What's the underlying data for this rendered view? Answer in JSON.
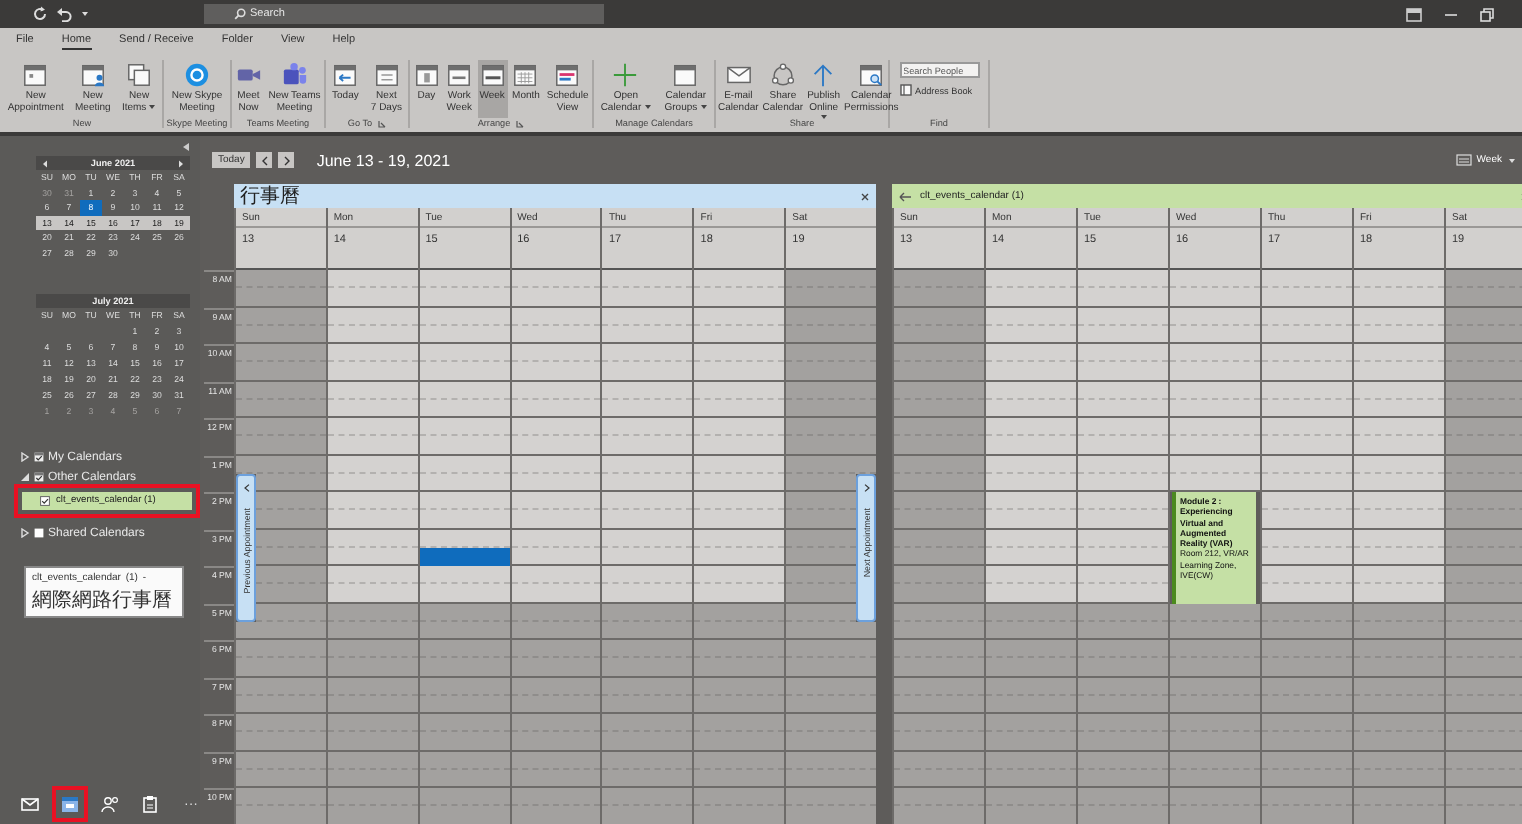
{
  "title_bar": {
    "search": {
      "placeholder": "Search"
    }
  },
  "ribbon_tabs": [
    {
      "label": "File",
      "selected": false
    },
    {
      "label": "Home",
      "selected": true
    },
    {
      "label": "Send / Receive",
      "selected": false
    },
    {
      "label": "Folder",
      "selected": false
    },
    {
      "label": "View",
      "selected": false
    },
    {
      "label": "Help",
      "selected": false
    }
  ],
  "ribbon_groups": [
    {
      "label": "New",
      "launcher": false,
      "items": [
        {
          "kind": "large",
          "label": "New\nAppointment",
          "dropdown": false,
          "selected": false
        },
        {
          "kind": "large",
          "label": "New\nMeeting",
          "dropdown": false,
          "selected": false
        },
        {
          "kind": "large",
          "label": "New\nItems",
          "dropdown": true,
          "selected": false
        }
      ]
    },
    {
      "label": "Skype Meeting",
      "launcher": false,
      "items": [
        {
          "kind": "large",
          "label": "New Skype\nMeeting",
          "dropdown": false,
          "selected": false
        }
      ]
    },
    {
      "label": "Teams Meeting",
      "launcher": false,
      "items": [
        {
          "kind": "large",
          "label": "Meet\nNow",
          "dropdown": false,
          "selected": false
        },
        {
          "kind": "large",
          "label": "New Teams\nMeeting",
          "dropdown": false,
          "selected": false
        }
      ]
    },
    {
      "label": "Go To",
      "launcher": true,
      "items": [
        {
          "kind": "large",
          "label": "Today",
          "dropdown": false,
          "selected": false
        },
        {
          "kind": "large",
          "label": "Next\n7 Days",
          "dropdown": false,
          "selected": false
        }
      ]
    },
    {
      "label": "Arrange",
      "launcher": true,
      "items": [
        {
          "kind": "large",
          "label": "Day",
          "dropdown": false,
          "selected": false
        },
        {
          "kind": "large",
          "label": "Work\nWeek",
          "dropdown": false,
          "selected": false
        },
        {
          "kind": "large",
          "label": "Week",
          "dropdown": false,
          "selected": true
        },
        {
          "kind": "large",
          "label": "Month",
          "dropdown": false,
          "selected": false
        },
        {
          "kind": "large",
          "label": "Schedule\nView",
          "dropdown": false,
          "selected": false
        }
      ]
    },
    {
      "label": "Manage Calendars",
      "launcher": false,
      "items": [
        {
          "kind": "large",
          "label": "Open\nCalendar",
          "dropdown": true,
          "selected": false
        },
        {
          "kind": "large",
          "label": "Calendar\nGroups",
          "dropdown": true,
          "selected": false
        }
      ]
    },
    {
      "label": "Share",
      "launcher": false,
      "items": [
        {
          "kind": "large",
          "label": "E-mail\nCalendar",
          "dropdown": false,
          "selected": false
        },
        {
          "kind": "large",
          "label": "Share\nCalendar",
          "dropdown": false,
          "selected": false
        },
        {
          "kind": "large",
          "label": "Publish\nOnline",
          "dropdown": true,
          "selected": false
        },
        {
          "kind": "large",
          "label": "Calendar\nPermissions",
          "dropdown": false,
          "selected": false
        }
      ]
    },
    {
      "label": "Find",
      "launcher": false,
      "items": [
        {
          "kind": "field",
          "placeholder": "Search People",
          "selected": false
        },
        {
          "kind": "small",
          "label": "Address Book",
          "dropdown": false,
          "selected": false
        }
      ]
    }
  ],
  "mini_months": [
    {
      "title": "June 2021",
      "arrows": true,
      "weekdays": [
        "SU",
        "MO",
        "TU",
        "WE",
        "TH",
        "FR",
        "SA"
      ],
      "weeks": [
        {
          "selected": false,
          "days": [
            {
              "day": "30",
              "other_month": true,
              "today": false
            },
            {
              "day": "31",
              "other_month": true,
              "today": false
            },
            {
              "day": "1",
              "other_month": false,
              "today": false
            },
            {
              "day": "2",
              "other_month": false,
              "today": false
            },
            {
              "day": "3",
              "other_month": false,
              "today": false
            },
            {
              "day": "4",
              "other_month": false,
              "today": false
            },
            {
              "day": "5",
              "other_month": false,
              "today": false
            }
          ]
        },
        {
          "selected": false,
          "days": [
            {
              "day": "6",
              "other_month": false,
              "today": false
            },
            {
              "day": "7",
              "other_month": false,
              "today": false
            },
            {
              "day": "8",
              "other_month": false,
              "today": true
            },
            {
              "day": "9",
              "other_month": false,
              "today": false
            },
            {
              "day": "10",
              "other_month": false,
              "today": false
            },
            {
              "day": "11",
              "other_month": false,
              "today": false
            },
            {
              "day": "12",
              "other_month": false,
              "today": false
            }
          ]
        },
        {
          "selected": true,
          "days": [
            {
              "day": "13",
              "other_month": false,
              "today": false
            },
            {
              "day": "14",
              "other_month": false,
              "today": false
            },
            {
              "day": "15",
              "other_month": false,
              "today": false
            },
            {
              "day": "16",
              "other_month": false,
              "today": false
            },
            {
              "day": "17",
              "other_month": false,
              "today": false
            },
            {
              "day": "18",
              "other_month": false,
              "today": false
            },
            {
              "day": "19",
              "other_month": false,
              "today": false
            }
          ]
        },
        {
          "selected": false,
          "days": [
            {
              "day": "20",
              "other_month": false,
              "today": false
            },
            {
              "day": "21",
              "other_month": false,
              "today": false
            },
            {
              "day": "22",
              "other_month": false,
              "today": false
            },
            {
              "day": "23",
              "other_month": false,
              "today": false
            },
            {
              "day": "24",
              "other_month": false,
              "today": false
            },
            {
              "day": "25",
              "other_month": false,
              "today": false
            },
            {
              "day": "26",
              "other_month": false,
              "today": false
            }
          ]
        },
        {
          "selected": false,
          "days": [
            {
              "day": "27",
              "other_month": false,
              "today": false
            },
            {
              "day": "28",
              "other_month": false,
              "today": false
            },
            {
              "day": "29",
              "other_month": false,
              "today": false
            },
            {
              "day": "30",
              "other_month": false,
              "today": false
            }
          ]
        }
      ]
    },
    {
      "title": "July 2021",
      "arrows": false,
      "weekdays": [
        "SU",
        "MO",
        "TU",
        "WE",
        "TH",
        "FR",
        "SA"
      ],
      "weeks": [
        {
          "selected": false,
          "days": [
            {
              "day": "1",
              "other_month": false,
              "today": false
            },
            {
              "day": "2",
              "other_month": false,
              "today": false
            },
            {
              "day": "3",
              "other_month": false,
              "today": false
            }
          ]
        },
        {
          "selected": false,
          "days": [
            {
              "day": "4",
              "other_month": false,
              "today": false
            },
            {
              "day": "5",
              "other_month": false,
              "today": false
            },
            {
              "day": "6",
              "other_month": false,
              "today": false
            },
            {
              "day": "7",
              "other_month": false,
              "today": false
            },
            {
              "day": "8",
              "other_month": false,
              "today": false
            },
            {
              "day": "9",
              "other_month": false,
              "today": false
            },
            {
              "day": "10",
              "other_month": false,
              "today": false
            }
          ]
        },
        {
          "selected": false,
          "days": [
            {
              "day": "11",
              "other_month": false,
              "today": false
            },
            {
              "day": "12",
              "other_month": false,
              "today": false
            },
            {
              "day": "13",
              "other_month": false,
              "today": false
            },
            {
              "day": "14",
              "other_month": false,
              "today": false
            },
            {
              "day": "15",
              "other_month": false,
              "today": false
            },
            {
              "day": "16",
              "other_month": false,
              "today": false
            },
            {
              "day": "17",
              "other_month": false,
              "today": false
            }
          ]
        },
        {
          "selected": false,
          "days": [
            {
              "day": "18",
              "other_month": false,
              "today": false
            },
            {
              "day": "19",
              "other_month": false,
              "today": false
            },
            {
              "day": "20",
              "other_month": false,
              "today": false
            },
            {
              "day": "21",
              "other_month": false,
              "today": false
            },
            {
              "day": "22",
              "other_month": false,
              "today": false
            },
            {
              "day": "23",
              "other_month": false,
              "today": false
            },
            {
              "day": "24",
              "other_month": false,
              "today": false
            }
          ]
        },
        {
          "selected": false,
          "days": [
            {
              "day": "25",
              "other_month": false,
              "today": false
            },
            {
              "day": "26",
              "other_month": false,
              "today": false
            },
            {
              "day": "27",
              "other_month": false,
              "today": false
            },
            {
              "day": "28",
              "other_month": false,
              "today": false
            },
            {
              "day": "29",
              "other_month": false,
              "today": false
            },
            {
              "day": "30",
              "other_month": false,
              "today": false
            },
            {
              "day": "31",
              "other_month": false,
              "today": false
            }
          ]
        },
        {
          "selected": false,
          "days": [
            {
              "day": "1",
              "other_month": true,
              "today": false
            },
            {
              "day": "2",
              "other_month": true,
              "today": false
            },
            {
              "day": "3",
              "other_month": true,
              "today": false
            },
            {
              "day": "4",
              "other_month": true,
              "today": false
            },
            {
              "day": "5",
              "other_month": true,
              "today": false
            },
            {
              "day": "6",
              "other_month": true,
              "today": false
            },
            {
              "day": "7",
              "other_month": true,
              "today": false
            }
          ]
        }
      ]
    }
  ],
  "calendar_groups": [
    {
      "label": "My Calendars",
      "expanded": false,
      "checked": true
    },
    {
      "label": "Other Calendars",
      "expanded": true,
      "checked": true,
      "items": [
        {
          "label": "clt_events_calendar (1)",
          "checked": true,
          "highlighted": true,
          "color": "#c5e0a5"
        }
      ]
    },
    {
      "label": "Shared Calendars",
      "expanded": false,
      "checked": false
    }
  ],
  "tooltip": {
    "text": "clt_events_calendar (1) - 網際網路行事曆"
  },
  "nav": {
    "items": [
      {
        "selected": false,
        "highlighted": false
      },
      {
        "selected": true,
        "highlighted": true
      },
      {
        "selected": false,
        "highlighted": false
      },
      {
        "selected": false,
        "highlighted": false
      }
    ],
    "more": "···"
  },
  "calendar_toolbar": {
    "today": "Today",
    "range": "June 13 - 19, 2021",
    "view": "Week"
  },
  "time_labels": [
    {
      "label": "8 AM",
      "work": true
    },
    {
      "label": "9 AM",
      "work": true
    },
    {
      "label": "10 AM",
      "work": true
    },
    {
      "label": "11 AM",
      "work": true
    },
    {
      "label": "12 PM",
      "work": true
    },
    {
      "label": "1 PM",
      "work": true
    },
    {
      "label": "2 PM",
      "work": true
    },
    {
      "label": "3 PM",
      "work": true
    },
    {
      "label": "4 PM",
      "work": true
    },
    {
      "label": "5 PM",
      "work": false
    },
    {
      "label": "6 PM",
      "work": false
    },
    {
      "label": "7 PM",
      "work": false
    },
    {
      "label": "8 PM",
      "work": false
    },
    {
      "label": "9 PM",
      "work": false
    },
    {
      "label": "10 PM",
      "work": false
    }
  ],
  "panels": [
    {
      "title": "行事曆",
      "color": "#c7e0f4",
      "back_arrow": false,
      "appointment_tabs": [
        {
          "kind": "previous",
          "label": "Previous Appointment"
        },
        {
          "kind": "next",
          "label": "Next Appointment"
        }
      ],
      "days": [
        {
          "name": "Sun",
          "date": "13",
          "workday": false
        },
        {
          "name": "Mon",
          "date": "14",
          "workday": true
        },
        {
          "name": "Tue",
          "date": "15",
          "workday": true,
          "events": [
            {
              "kind": "selection",
              "half_hours": [
                false,
                false,
                false,
                false,
                false,
                false,
                false,
                false,
                false,
                false,
                false,
                false,
                false,
                false,
                false,
                true
              ]
            }
          ]
        },
        {
          "name": "Wed",
          "date": "16",
          "workday": true
        },
        {
          "name": "Thu",
          "date": "17",
          "workday": true
        },
        {
          "name": "Fri",
          "date": "18",
          "workday": true
        },
        {
          "name": "Sat",
          "date": "19",
          "workday": false
        }
      ]
    },
    {
      "title": "clt_events_calendar (1)",
      "color": "#c5e0a5",
      "back_arrow": true,
      "days": [
        {
          "name": "Sun",
          "date": "13",
          "workday": false
        },
        {
          "name": "Mon",
          "date": "14",
          "workday": true
        },
        {
          "name": "Tue",
          "date": "15",
          "workday": true
        },
        {
          "name": "Wed",
          "date": "16",
          "workday": true,
          "events": [
            {
              "kind": "appointment",
              "half_hours": [
                false,
                false,
                false,
                false,
                false,
                false,
                false,
                false,
                false,
                false,
                false,
                false,
                true,
                true,
                true,
                true,
                true,
                true
              ],
              "title": "Module 2 : Experiencing Virtual and Augmented Reality  (VAR)",
              "location": "Room 212, VR/AR Learning Zone, IVE(CW)"
            }
          ]
        },
        {
          "name": "Thu",
          "date": "17",
          "workday": true
        },
        {
          "name": "Fri",
          "date": "18",
          "workday": true
        },
        {
          "name": "Sat",
          "date": "19",
          "workday": false
        }
      ]
    }
  ]
}
